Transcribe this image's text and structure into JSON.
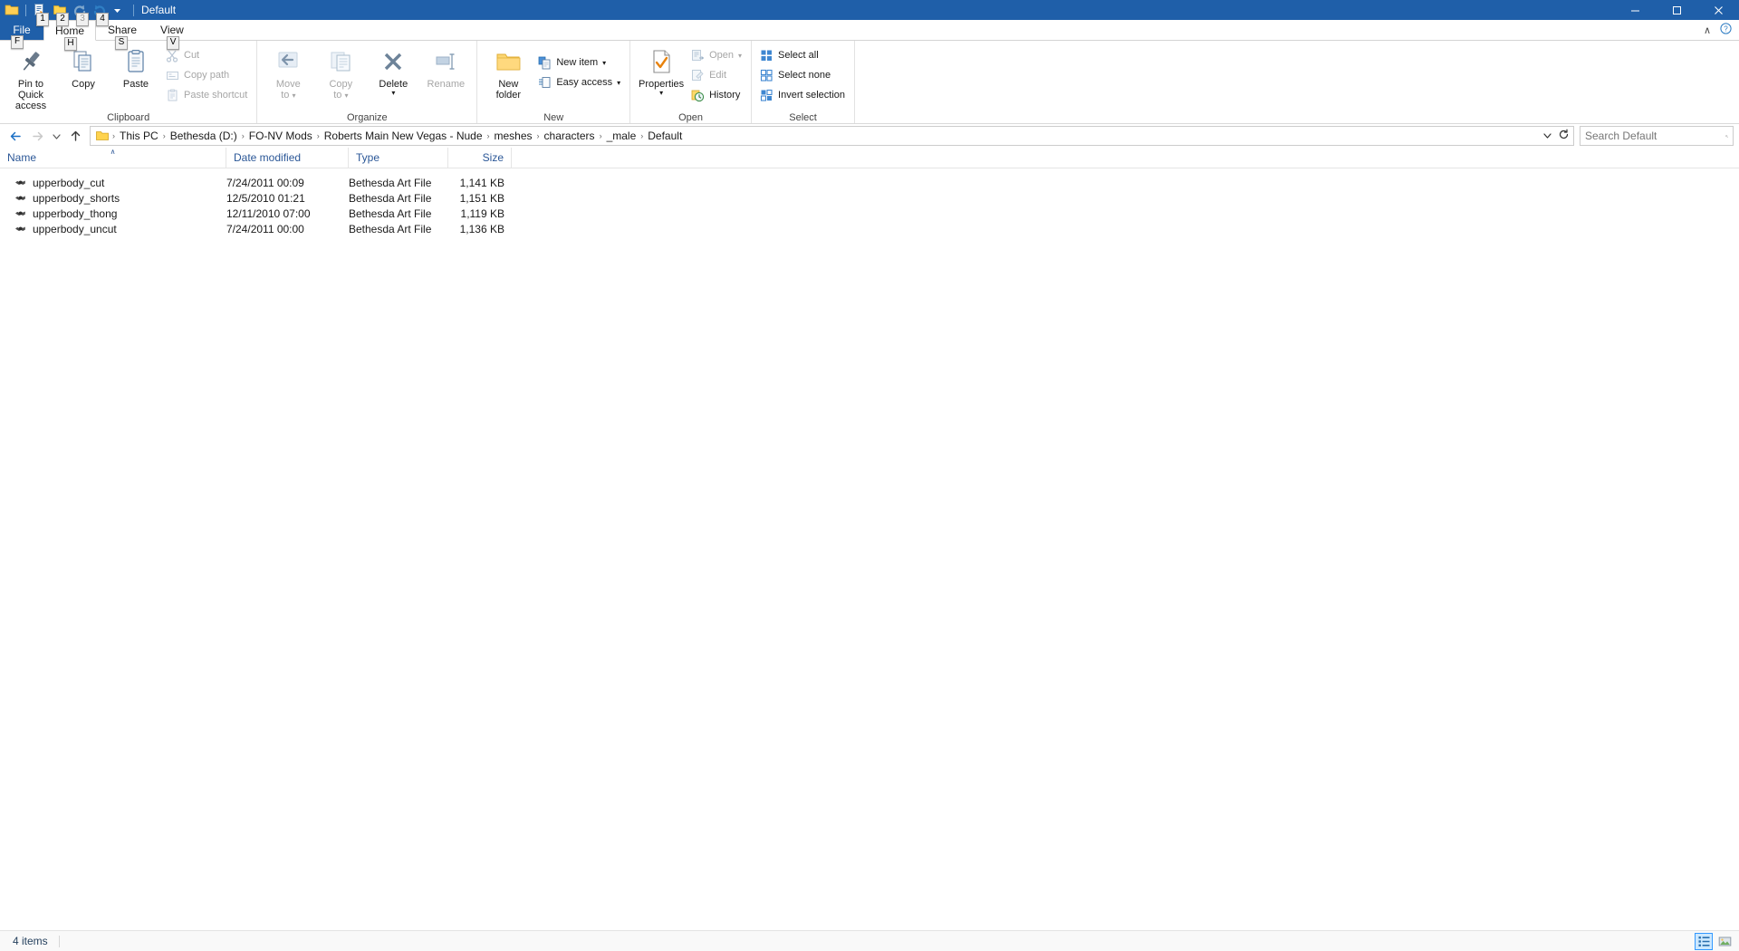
{
  "window": {
    "title": "Default",
    "minimize_label": "–",
    "maximize_label": "❐",
    "close_label": "✕"
  },
  "quick_access_toolbar": {
    "items": [
      {
        "name": "explorer-icon",
        "keytip": "",
        "disabled": false
      },
      {
        "name": "properties-icon",
        "keytip": "1",
        "disabled": false
      },
      {
        "name": "new-folder-icon",
        "keytip": "2",
        "disabled": false
      },
      {
        "name": "redo-icon",
        "keytip": "3",
        "disabled": true
      },
      {
        "name": "undo-icon",
        "keytip": "4",
        "disabled": false
      }
    ],
    "customize_keytip": ""
  },
  "ribbon": {
    "tabs": [
      {
        "label": "File",
        "keytip": "F",
        "active": false
      },
      {
        "label": "Home",
        "keytip": "H",
        "active": true
      },
      {
        "label": "Share",
        "keytip": "S",
        "active": false
      },
      {
        "label": "View",
        "keytip": "V",
        "active": false
      }
    ],
    "collapse_label": "∧",
    "help_label": "?",
    "groups": [
      {
        "name": "clipboard",
        "label": "Clipboard",
        "big_buttons": [
          {
            "label": "Pin to Quick\naccess",
            "line1": "Pin to Quick",
            "line2": "access",
            "icon": "pin-icon",
            "disabled": false,
            "dropdown": false
          },
          {
            "label": "Copy",
            "line1": "Copy",
            "line2": "",
            "icon": "copy-icon",
            "disabled": false,
            "dropdown": false
          },
          {
            "label": "Paste",
            "line1": "Paste",
            "line2": "",
            "icon": "paste-icon",
            "disabled": false,
            "dropdown": false
          }
        ],
        "small_buttons": [
          {
            "label": "Cut",
            "icon": "scissors-icon",
            "disabled": true
          },
          {
            "label": "Copy path",
            "icon": "copy-path-icon",
            "disabled": true
          },
          {
            "label": "Paste shortcut",
            "icon": "paste-shortcut-icon",
            "disabled": true
          }
        ]
      },
      {
        "name": "organize",
        "label": "Organize",
        "big_buttons": [
          {
            "label": "Move to",
            "line1": "Move",
            "line2": "to",
            "icon": "move-to-icon",
            "disabled": true,
            "dropdown": true
          },
          {
            "label": "Copy to",
            "line1": "Copy",
            "line2": "to",
            "icon": "copy-to-icon",
            "disabled": true,
            "dropdown": true
          },
          {
            "label": "Delete",
            "line1": "Delete",
            "line2": "",
            "icon": "delete-icon",
            "disabled": false,
            "dropdown": true
          },
          {
            "label": "Rename",
            "line1": "Rename",
            "line2": "",
            "icon": "rename-icon",
            "disabled": true,
            "dropdown": false
          }
        ],
        "small_buttons": []
      },
      {
        "name": "new",
        "label": "New",
        "big_buttons": [
          {
            "label": "New folder",
            "line1": "New",
            "line2": "folder",
            "icon": "new-folder-icon",
            "disabled": false,
            "dropdown": false
          }
        ],
        "small_buttons": [
          {
            "label": "New item",
            "icon": "new-item-icon",
            "disabled": false,
            "dropdown": true
          },
          {
            "label": "Easy access",
            "icon": "easy-access-icon",
            "disabled": false,
            "dropdown": true
          }
        ]
      },
      {
        "name": "open",
        "label": "Open",
        "big_buttons": [
          {
            "label": "Properties",
            "line1": "Properties",
            "line2": "",
            "icon": "properties-icon",
            "disabled": false,
            "dropdown": true
          }
        ],
        "small_buttons": [
          {
            "label": "Open",
            "icon": "open-icon",
            "disabled": true,
            "dropdown": true
          },
          {
            "label": "Edit",
            "icon": "edit-icon",
            "disabled": true
          },
          {
            "label": "History",
            "icon": "history-icon",
            "disabled": false
          }
        ]
      },
      {
        "name": "select",
        "label": "Select",
        "big_buttons": [],
        "small_buttons": [
          {
            "label": "Select all",
            "icon": "select-all-icon",
            "disabled": false
          },
          {
            "label": "Select none",
            "icon": "select-none-icon",
            "disabled": false
          },
          {
            "label": "Invert selection",
            "icon": "invert-selection-icon",
            "disabled": false
          }
        ]
      }
    ]
  },
  "navigation": {
    "back_label": "←",
    "forward_label": "→",
    "recent_label": "⌄",
    "up_label": "↑",
    "breadcrumbs": [
      "This PC",
      "Bethesda (D:)",
      "FO-NV Mods",
      "Roberts Main New Vegas - Nude",
      "meshes",
      "characters",
      "_male",
      "Default"
    ],
    "separator": "›",
    "dropdown_label": "⌄",
    "refresh_label": "↻"
  },
  "search": {
    "placeholder": "Search Default",
    "value": "",
    "icon": "search-icon"
  },
  "file_list": {
    "columns": [
      {
        "key": "name",
        "label": "Name",
        "sorted": true,
        "sort_caret": "∧"
      },
      {
        "key": "date",
        "label": "Date modified",
        "sorted": false,
        "sort_caret": ""
      },
      {
        "key": "type",
        "label": "Type",
        "sorted": false,
        "sort_caret": ""
      },
      {
        "key": "size",
        "label": "Size",
        "sorted": false,
        "sort_caret": ""
      }
    ],
    "rows": [
      {
        "name": "upperbody_cut",
        "date": "7/24/2011 00:09",
        "type": "Bethesda Art File",
        "size": "1,141 KB",
        "icon": "nif-file-icon"
      },
      {
        "name": "upperbody_shorts",
        "date": "12/5/2010 01:21",
        "type": "Bethesda Art File",
        "size": "1,151 KB",
        "icon": "nif-file-icon"
      },
      {
        "name": "upperbody_thong",
        "date": "12/11/2010 07:00",
        "type": "Bethesda Art File",
        "size": "1,119 KB",
        "icon": "nif-file-icon"
      },
      {
        "name": "upperbody_uncut",
        "date": "7/24/2011 00:00",
        "type": "Bethesda Art File",
        "size": "1,136 KB",
        "icon": "nif-file-icon"
      }
    ]
  },
  "status_bar": {
    "item_count": "4 items",
    "views": [
      {
        "name": "details-view-button",
        "selected": true
      },
      {
        "name": "large-icons-view-button",
        "selected": false
      }
    ]
  },
  "colors": {
    "title_bar": "#1f5fa9",
    "accent": "#2b5797",
    "selection": "#cce8ff",
    "folder": "#ffd34e"
  }
}
